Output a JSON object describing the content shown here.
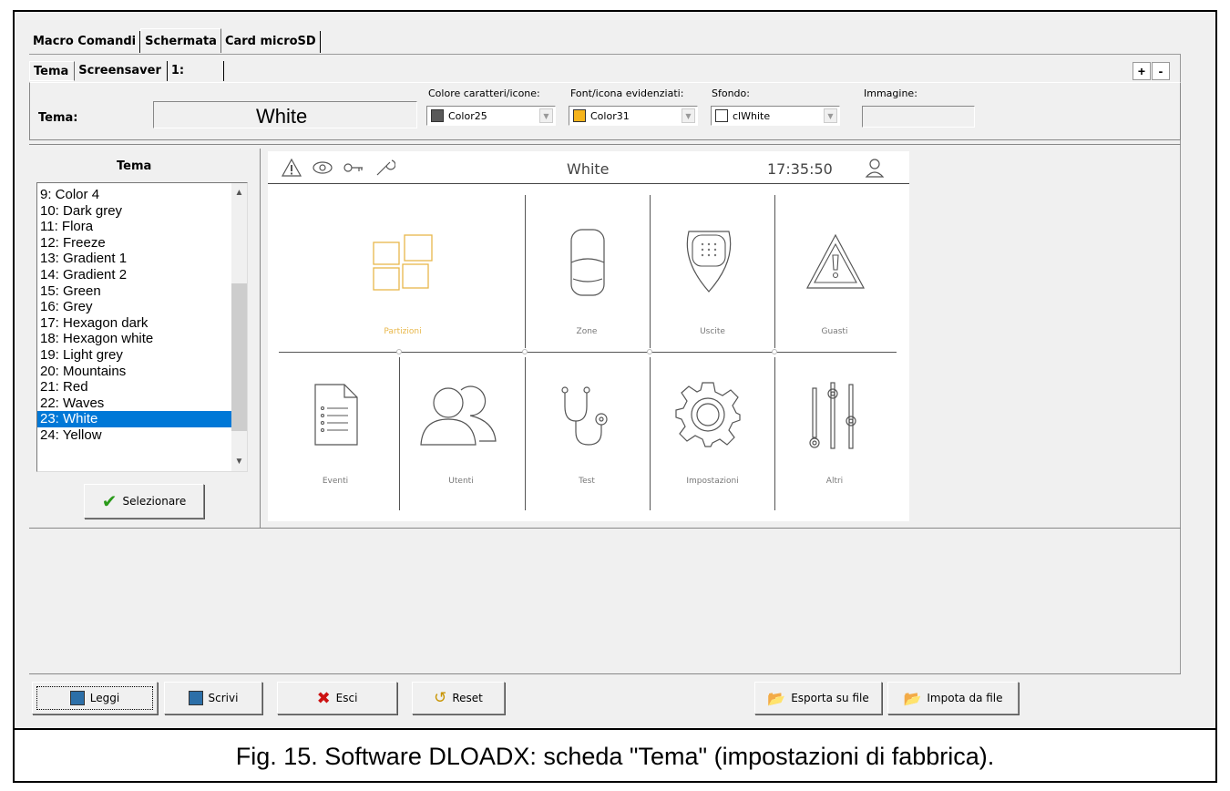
{
  "tabs_top": [
    "Macro Comandi",
    "Schermata",
    "Card microSD"
  ],
  "tabs_sub": [
    "Tema",
    "Screensaver",
    "1:"
  ],
  "plus_minus": [
    "+",
    "-"
  ],
  "tema": {
    "label": "Tema:",
    "name": "White",
    "text_color_label": "Colore caratteri/icone:",
    "text_color_value": "Color25",
    "text_color_hex": "#595959",
    "highlight_label": "Font/icona evidenziati:",
    "highlight_value": "Color31",
    "highlight_hex": "#f5b41c",
    "bg_label": "Sfondo:",
    "bg_value": "clWhite",
    "bg_hex": "#ffffff",
    "image_label": "Immagine:"
  },
  "theme_list": {
    "title": "Tema",
    "items": [
      "9: Color 4",
      "10: Dark grey",
      "11: Flora",
      "12: Freeze",
      "13: Gradient 1",
      "14: Gradient 2",
      "15: Green",
      "16: Grey",
      "17: Hexagon dark",
      "18: Hexagon white",
      "19: Light grey",
      "20: Mountains",
      "21: Red",
      "22: Waves",
      "23: White",
      "24: Yellow"
    ],
    "selected": "23: White",
    "select_button": "Selezionare"
  },
  "preview": {
    "title": "White",
    "time": "17:35:50",
    "tiles": [
      "Partizioni",
      "Zone",
      "Uscite",
      "Guasti",
      "Eventi",
      "Utenti",
      "Test",
      "Impostazioni",
      "Altri"
    ]
  },
  "buttons": {
    "read": "Leggi",
    "write": "Scrivi",
    "exit": "Esci",
    "reset": "Reset",
    "export": "Esporta su file",
    "import": "Impota da file"
  },
  "caption": "Fig. 15. Software DLOADX: scheda \"Tema\" (impostazioni di fabbrica)."
}
